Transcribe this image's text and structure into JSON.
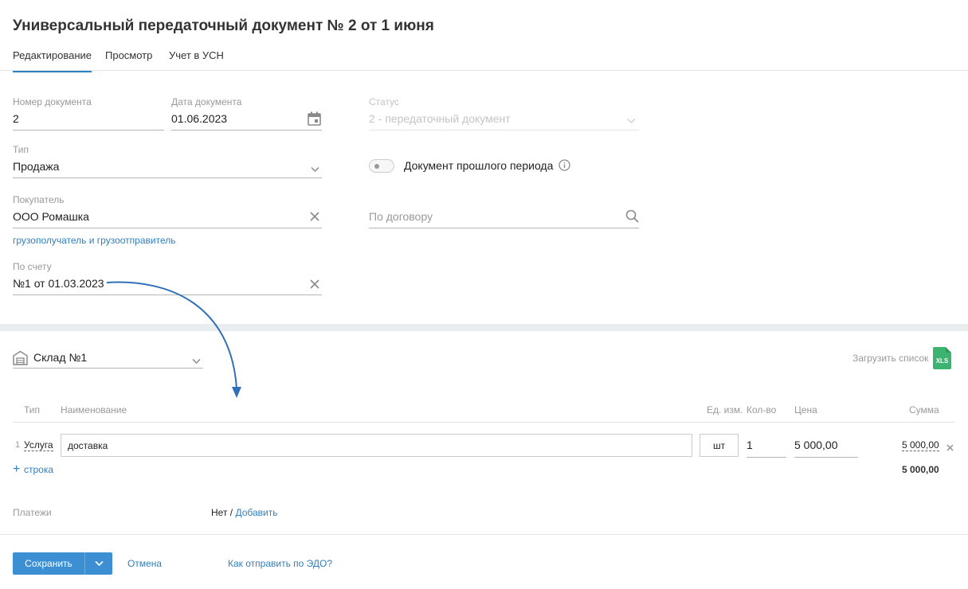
{
  "header": {
    "title": "Универсальный передаточный документ № 2 от 1 июня",
    "tabs": [
      {
        "label": "Редактирование",
        "active": true
      },
      {
        "label": "Просмотр",
        "active": false
      },
      {
        "label": "Учет в УСН",
        "active": false
      }
    ]
  },
  "form": {
    "doc_number": {
      "label": "Номер документа",
      "value": "2"
    },
    "doc_date": {
      "label": "Дата документа",
      "value": "01.06.2023",
      "icon": "calendar-icon"
    },
    "status": {
      "label": "Статус",
      "value": "2 - передаточный документ"
    },
    "type": {
      "label": "Тип",
      "value": "Продажа"
    },
    "past_period": {
      "label": "Документ прошлого периода",
      "checked": false
    },
    "buyer": {
      "label": "Покупатель",
      "value": "ООО Ромашка"
    },
    "contract": {
      "placeholder": "По договору"
    },
    "consignee_link": "грузополучатель и грузоотправитель",
    "invoice": {
      "label": "По счету",
      "value": "№1 от 01.03.2023"
    }
  },
  "items": {
    "warehouse": "Склад №1",
    "upload_label": "Загрузить список",
    "upload_badge": "XLS",
    "columns": {
      "type": "Тип",
      "name": "Наименование",
      "unit": "Ед. изм.",
      "qty": "Кол-во",
      "price": "Цена",
      "sum": "Сумма"
    },
    "rows": [
      {
        "index": "1",
        "type": "Услуга",
        "name": "доставка",
        "unit": "шт",
        "qty": "1",
        "price": "5 000,00",
        "sum": "5 000,00"
      }
    ],
    "add_row": "строка",
    "total": "5 000,00"
  },
  "payments": {
    "label": "Платежи",
    "none": "Нет",
    "separator": " / ",
    "add": "Добавить"
  },
  "footer": {
    "save": "Сохранить",
    "cancel": "Отмена",
    "edo_link": "Как отправить по ЭДО?"
  },
  "colors": {
    "accent": "#2f7fc1",
    "save_button": "#3b8fd2",
    "xls_badge": "#3cb371",
    "annotation_arrow": "#2f70b8"
  }
}
